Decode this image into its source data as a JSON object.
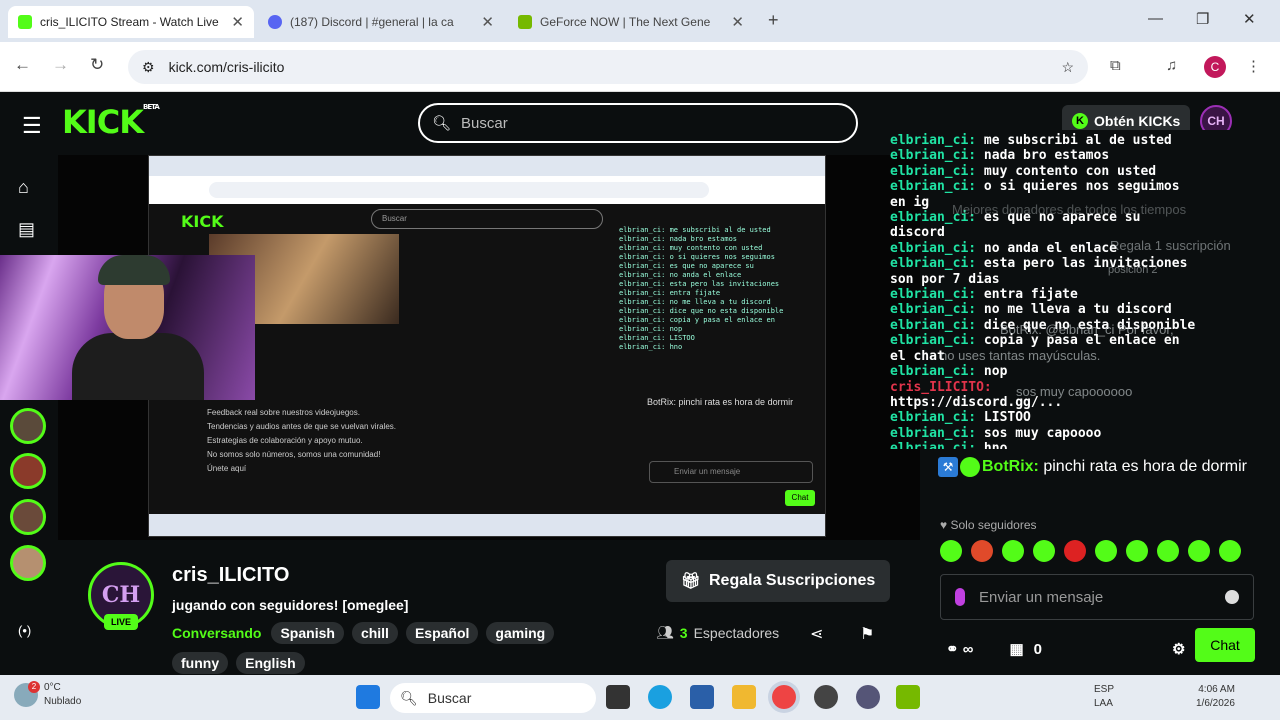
{
  "browser": {
    "tabs": [
      {
        "title": "cris_ILICITO Stream - Watch Live",
        "favicon_color": "#53fc18"
      },
      {
        "title": "(187) Discord | #general | la ca",
        "favicon_color": "#5865f2"
      },
      {
        "title": "GeForce NOW | The Next Gene",
        "favicon_color": "#76b900"
      }
    ],
    "url": "kick.com/cris-ilicito",
    "profile_initial": "C"
  },
  "header": {
    "logo": "KICK",
    "logo_badge": "BETA",
    "search_placeholder": "Buscar",
    "get_kicks": "Obtén KICKs",
    "avatar_initials": "CH"
  },
  "stream": {
    "channel_name": "cris_ILICITO",
    "title": "jugando con seguidores! [omeglee]",
    "live_label": "LIVE",
    "avatar_initials": "CH",
    "category": "Conversando",
    "tags": [
      "Spanish",
      "chill",
      "Español",
      "gaming",
      "funny",
      "English"
    ],
    "gift_button": "Regala Suscripciones",
    "viewers_count": "3",
    "viewers_label": "Espectadores"
  },
  "chat": {
    "lines": [
      {
        "user": "elbrian_ci:",
        "text": " me subscribi al de usted"
      },
      {
        "user": "elbrian_ci:",
        "text": " nada bro estamos"
      },
      {
        "user": "elbrian_ci:",
        "text": " muy contento con usted"
      },
      {
        "user": "elbrian_ci:",
        "text": " o si quieres nos seguimos"
      },
      {
        "user": "",
        "text": "en ig"
      },
      {
        "user": "elbrian_ci:",
        "text": " es que no aparece su"
      },
      {
        "user": "",
        "text": "discord"
      },
      {
        "user": "elbrian_ci:",
        "text": " no anda el enlace"
      },
      {
        "user": "elbrian_ci:",
        "text": " esta pero las invitaciones"
      },
      {
        "user": "",
        "text": "son por 7 dias"
      },
      {
        "user": "elbrian_ci:",
        "text": " entra fijate"
      },
      {
        "user": "elbrian_ci:",
        "text": " no me lleva a tu discord"
      },
      {
        "user": "elbrian_ci:",
        "text": " dice que no esta disponible"
      },
      {
        "user": "elbrian_ci:",
        "text": " copia y pasa el enlace en"
      },
      {
        "user": "",
        "text": "el chat"
      },
      {
        "user": "elbrian_ci:",
        "text": " nop"
      },
      {
        "user": "cris_ILICITO:",
        "text": ""
      },
      {
        "user": "",
        "text": "https://discord.gg/..."
      },
      {
        "user": "elbrian_ci:",
        "text": " LISTOO"
      },
      {
        "user": "elbrian_ci:",
        "text": " sos muy capoooo"
      },
      {
        "user": "elbrian_ci:",
        "text": " hno"
      }
    ],
    "ghost_texts": [
      "Mejores donadores de todos los tiempos",
      "Regala 1 suscripción",
      "posición 2",
      "BotRix: @elbrian_ci Por favor,",
      "no uses tantas mayúsculas.",
      "sos muy capoooooo"
    ],
    "bot_name": "BotRix:",
    "bot_message": " pinchi rata es hora de dormir",
    "followers_only": "Solo seguidores",
    "input_placeholder": "Enviar un mensaje",
    "kicks_count": "0",
    "chat_button": "Chat",
    "emote_colors": [
      "#53fc18",
      "#e04a2a",
      "#53fc18",
      "#53fc18",
      "#d22",
      "#53fc18",
      "#53fc18",
      "#53fc18",
      "#53fc18",
      "#53fc18"
    ]
  },
  "inner_stream": {
    "search_placeholder": "Buscar",
    "input_placeholder": "Enviar un mensaje",
    "chat_button": "Chat",
    "bot_line": "BotRix: pinchi rata es hora de dormir",
    "text_lines": [
      "Feedback real sobre nuestros videojuegos.",
      "Tendencias y audios antes de que se vuelvan virales.",
      "Estrategias de colaboración y apoyo mutuo.",
      "No somos solo números, somos una comunidad!",
      "Únete aquí"
    ]
  },
  "taskbar": {
    "weather_temp": "0°C",
    "weather_desc": "Nublado",
    "notification_count": "2",
    "search_placeholder": "Buscar",
    "lang_top": "ESP",
    "lang_bottom": "LAA",
    "time": "4:06 AM",
    "date": "1/6/2026"
  }
}
